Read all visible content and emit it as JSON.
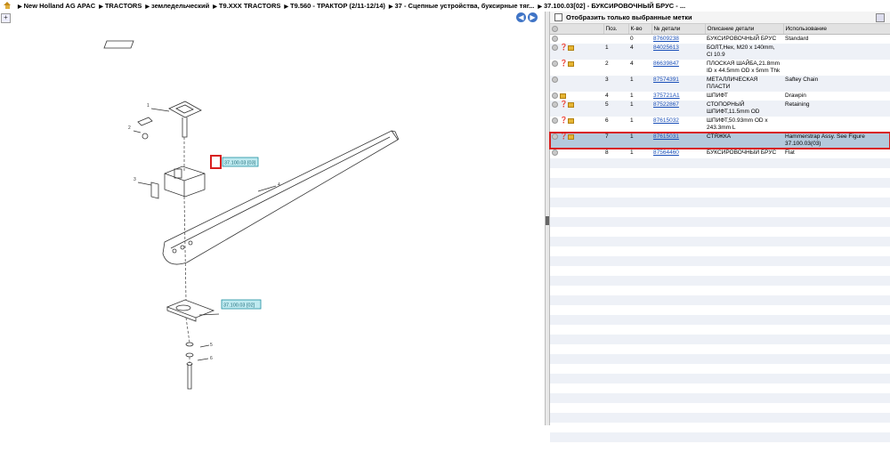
{
  "breadcrumb": [
    "New Holland AG APAC",
    "TRACTORS",
    "земледельческий",
    "T9.XXX TRACTORS",
    "T9.560 - ТРАКТОР (2/11-12/14)",
    "37 - Сцепные устройства, буксирные тяг...",
    "37.100.03[02] - БУКСИРОВОЧНЫЙ БРУС - ..."
  ],
  "filter": {
    "label": "Отобразить только выбранные метки"
  },
  "columns": [
    "Поз.",
    "К-во",
    "№ детали",
    "Описание детали",
    "Использование"
  ],
  "rows": [
    {
      "pos": "",
      "qty": "0",
      "part": "87609238",
      "desc": "БУКСИРОВОЧНЫЙ БРУС",
      "usage": "Standard",
      "icons": 1
    },
    {
      "pos": "1",
      "qty": "4",
      "part": "84025613",
      "desc": "БОЛТ,Hex, M20 x 140mm, Cl 10.9",
      "usage": "",
      "icons": 3
    },
    {
      "pos": "2",
      "qty": "4",
      "part": "86639847",
      "desc": "ПЛОСКАЯ ШАЙБА,21.8mm ID x 44.5mm OD x 5mm Thk",
      "usage": "",
      "icons": 3
    },
    {
      "pos": "3",
      "qty": "1",
      "part": "87574391",
      "desc": "МЕТАЛЛИЧЕСКАЯ ПЛАСТИ",
      "usage": "Saftey Chain",
      "icons": 1
    },
    {
      "pos": "4",
      "qty": "1",
      "part": "375721A1",
      "desc": "ШПИФТ",
      "usage": "Drawpin",
      "icons": 2
    },
    {
      "pos": "5",
      "qty": "1",
      "part": "87522867",
      "desc": "СТОПОРНЫЙ ШПИФТ,11.5mm OD",
      "usage": "Retaining",
      "icons": 3
    },
    {
      "pos": "6",
      "qty": "1",
      "part": "87615032",
      "desc": "ШПИФТ,50.93mm OD x 243.3mm L",
      "usage": "",
      "icons": 3
    },
    {
      "pos": "7",
      "qty": "1",
      "part": "87615031",
      "desc": "СТЯЖКА",
      "usage": "Hammerstrap Assy. See Figure 37.100.03(03)",
      "icons": 3,
      "selected": true
    },
    {
      "pos": "8",
      "qty": "1",
      "part": "87564460",
      "desc": "БУКСИРОВОЧНЫЙ БРУС",
      "usage": "Flat",
      "icons": 1
    }
  ],
  "drawing": {
    "callouts": [
      "37.100.03 [03]",
      "37.100.03 [02]"
    ]
  }
}
